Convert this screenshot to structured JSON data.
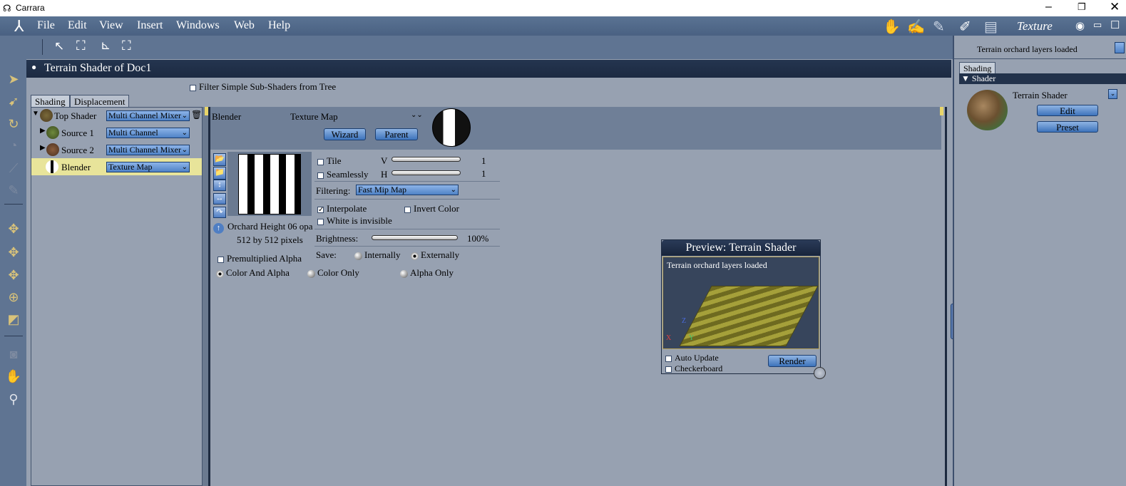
{
  "app": {
    "title": "Carrara",
    "room": "Texture"
  },
  "menu": [
    "File",
    "Edit",
    "View",
    "Insert",
    "Windows",
    "Web",
    "Help"
  ],
  "document": {
    "title": "Terrain Shader of Doc1",
    "filter_label": "Filter Simple Sub-Shaders from Tree"
  },
  "tabs": {
    "shading": "Shading",
    "displacement": "Displacement"
  },
  "tree": [
    {
      "label": "Top Shader",
      "type": "Multi Channel Mixer"
    },
    {
      "label": "Source 1",
      "type": "Multi Channel"
    },
    {
      "label": "Source 2",
      "type": "Multi Channel Mixer"
    },
    {
      "label": "Blender",
      "type": "Texture Map"
    }
  ],
  "editor": {
    "name": "Blender",
    "type": "Texture Map",
    "wizard": "Wizard",
    "parent": "Parent",
    "image_name": "Orchard Height 06 opa",
    "image_size": "512 by 512 pixels",
    "tile": "Tile",
    "seamlessly": "Seamlessly",
    "v_label": "V",
    "h_label": "H",
    "v_value": "1",
    "h_value": "1",
    "filtering_label": "Filtering:",
    "filtering_value": "Fast Mip Map",
    "interpolate": "Interpolate",
    "invert_color": "Invert Color",
    "white_invisible": "White is invisible",
    "brightness_label": "Brightness:",
    "brightness_value": "100%",
    "save_label": "Save:",
    "internally": "Internally",
    "externally": "Externally",
    "premultiplied": "Premultiplied Alpha",
    "color_and_alpha": "Color And Alpha",
    "color_only": "Color Only",
    "alpha_only": "Alpha Only"
  },
  "preview": {
    "title": "Preview: Terrain Shader",
    "status": "Terrain orchard layers loaded",
    "auto_update": "Auto Update",
    "checkerboard": "Checkerboard",
    "render": "Render"
  },
  "right_panel": {
    "status": "Terrain orchard layers loaded",
    "tab": "Shading",
    "section": "Shader",
    "shader_name": "Terrain Shader",
    "edit": "Edit",
    "preset": "Preset"
  },
  "colors": {
    "menubar": "#4f6687",
    "accent": "#3d73bb",
    "doc_title": "#1e2c45",
    "highlight": "#e8e49a"
  }
}
